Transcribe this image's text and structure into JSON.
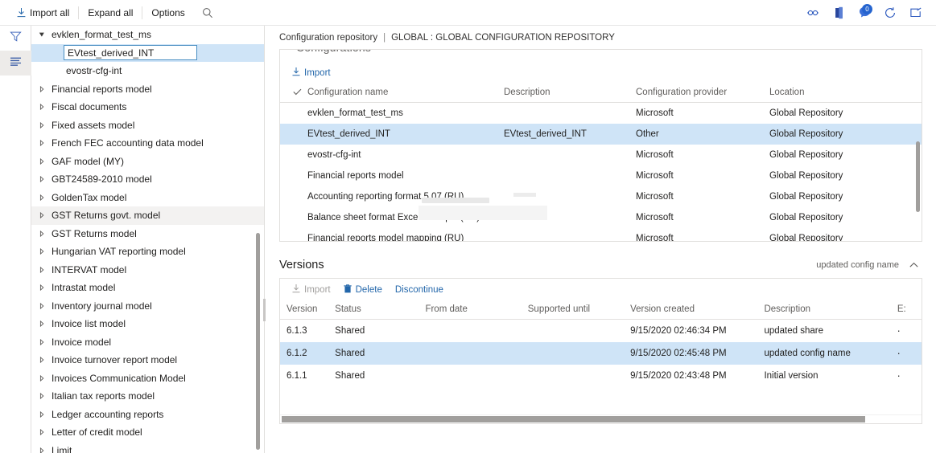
{
  "topbar": {
    "commands": [
      {
        "id": "import-all",
        "label": "Import all",
        "icon": "download-icon"
      },
      {
        "id": "expand-all",
        "label": "Expand all",
        "icon": "none"
      },
      {
        "id": "options",
        "label": "Options",
        "icon": "none"
      },
      {
        "id": "search",
        "label": "",
        "icon": "search-icon"
      }
    ],
    "right_icons": [
      {
        "id": "link",
        "name": "link-icon"
      },
      {
        "id": "office",
        "name": "office-apps-icon"
      },
      {
        "id": "messages",
        "name": "messages-icon",
        "badge": "0",
        "badge_color": "#2564cf"
      },
      {
        "id": "refresh",
        "name": "refresh-icon"
      },
      {
        "id": "popout",
        "name": "open-in-new-window-icon"
      }
    ]
  },
  "rail": {
    "buttons": [
      {
        "id": "filter",
        "name": "filter-icon",
        "active": false
      },
      {
        "id": "list",
        "name": "list-view-icon",
        "active": true
      }
    ]
  },
  "tree": {
    "root": {
      "label": "evklen_format_test_ms",
      "expanded": true
    },
    "editing": {
      "value": "EVtest_derived_INT",
      "selected": true
    },
    "items": [
      {
        "label": "evostr-cfg-int",
        "indent": 1,
        "expandable": false,
        "hovered": false
      },
      {
        "label": "Financial reports model",
        "indent": 0,
        "expandable": true,
        "hovered": false
      },
      {
        "label": "Fiscal documents",
        "indent": 0,
        "expandable": true,
        "hovered": false
      },
      {
        "label": "Fixed assets model",
        "indent": 0,
        "expandable": true,
        "hovered": false
      },
      {
        "label": "French FEC accounting data model",
        "indent": 0,
        "expandable": true,
        "hovered": false
      },
      {
        "label": "GAF model (MY)",
        "indent": 0,
        "expandable": true,
        "hovered": false
      },
      {
        "label": "GBT24589-2010 model",
        "indent": 0,
        "expandable": true,
        "hovered": false
      },
      {
        "label": "GoldenTax model",
        "indent": 0,
        "expandable": true,
        "hovered": false
      },
      {
        "label": "GST Returns govt. model",
        "indent": 0,
        "expandable": true,
        "hovered": true
      },
      {
        "label": "GST Returns model",
        "indent": 0,
        "expandable": true,
        "hovered": false
      },
      {
        "label": "Hungarian VAT reporting model",
        "indent": 0,
        "expandable": true,
        "hovered": false
      },
      {
        "label": "INTERVAT model",
        "indent": 0,
        "expandable": true,
        "hovered": false
      },
      {
        "label": "Intrastat model",
        "indent": 0,
        "expandable": true,
        "hovered": false
      },
      {
        "label": "Inventory journal model",
        "indent": 0,
        "expandable": true,
        "hovered": false
      },
      {
        "label": "Invoice list model",
        "indent": 0,
        "expandable": true,
        "hovered": false
      },
      {
        "label": "Invoice model",
        "indent": 0,
        "expandable": true,
        "hovered": false
      },
      {
        "label": "Invoice turnover report model",
        "indent": 0,
        "expandable": true,
        "hovered": false
      },
      {
        "label": "Invoices Communication Model",
        "indent": 0,
        "expandable": true,
        "hovered": false
      },
      {
        "label": "Italian tax reports model",
        "indent": 0,
        "expandable": true,
        "hovered": false
      },
      {
        "label": "Ledger accounting reports",
        "indent": 0,
        "expandable": true,
        "hovered": false
      },
      {
        "label": "Letter of credit model",
        "indent": 0,
        "expandable": true,
        "hovered": false
      },
      {
        "label": "Limit",
        "indent": 0,
        "expandable": true,
        "hovered": false
      }
    ]
  },
  "breadcrumb": {
    "page": "Configuration repository",
    "separator": "|",
    "current": "GLOBAL : GLOBAL CONFIGURATION REPOSITORY"
  },
  "configurations": {
    "import_label": "Import",
    "columns": [
      "Configuration name",
      "Description",
      "Configuration provider",
      "Location"
    ],
    "rows": [
      {
        "name": "evklen_format_test_ms",
        "description": "",
        "provider": "Microsoft",
        "location": "Global Repository",
        "selected": false
      },
      {
        "name": "EVtest_derived_INT",
        "description": "EVtest_derived_INT",
        "provider": "Other",
        "location": "Global Repository",
        "selected": true
      },
      {
        "name": "evostr-cfg-int",
        "description": "",
        "provider": "Microsoft",
        "location": "Global Repository",
        "selected": false
      },
      {
        "name": "Financial reports model",
        "description": "",
        "provider": "Microsoft",
        "location": "Global Repository",
        "selected": false
      },
      {
        "name": "Accounting reporting format 5.07 (RU)",
        "description": "",
        "provider": "Microsoft",
        "location": "Global Repository",
        "selected": false
      },
      {
        "name": "Balance sheet format Excel example (RU)",
        "description": "",
        "provider": "Microsoft",
        "location": "Global Repository",
        "selected": false
      },
      {
        "name": "Financial reports model mapping (RU)",
        "description": "",
        "provider": "Microsoft",
        "location": "Global Repository",
        "selected": false
      }
    ]
  },
  "versions": {
    "title": "Versions",
    "summary": "updated config name",
    "collapse_icon": "chevron-up-icon",
    "toolbar": [
      {
        "id": "import",
        "label": "Import",
        "icon": "download-icon",
        "disabled": true
      },
      {
        "id": "delete",
        "label": "Delete",
        "icon": "trash-icon",
        "disabled": false
      },
      {
        "id": "discontinue",
        "label": "Discontinue",
        "icon": "none",
        "disabled": false
      }
    ],
    "columns": [
      "Version",
      "Status",
      "From date",
      "Supported until",
      "Version created",
      "Description",
      "E:"
    ],
    "rows": [
      {
        "version": "6.1.3",
        "status": "Shared",
        "from_date": "",
        "supported_until": "",
        "created": "9/15/2020 02:46:34 PM",
        "description": "updated share",
        "extra": "",
        "selected": false
      },
      {
        "version": "6.1.2",
        "status": "Shared",
        "from_date": "",
        "supported_until": "",
        "created": "9/15/2020 02:45:48 PM",
        "description": "updated config name",
        "extra": "",
        "selected": true
      },
      {
        "version": "6.1.1",
        "status": "Shared",
        "from_date": "",
        "supported_until": "",
        "created": "9/15/2020 02:43:48 PM",
        "description": "Initial version",
        "extra": "",
        "selected": false
      }
    ]
  },
  "colors": {
    "accent": "#2266aa",
    "selection": "#cfe4f7",
    "badge": "#2564cf",
    "border": "#e1dfdd"
  }
}
